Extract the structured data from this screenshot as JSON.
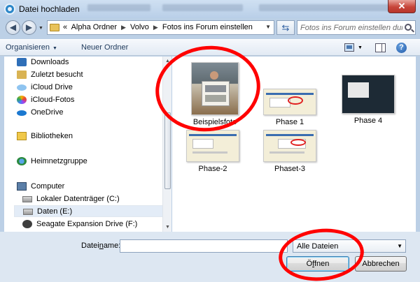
{
  "window": {
    "title": "Datei hochladen",
    "close_label": "✕"
  },
  "address": {
    "prefix": "«",
    "crumbs": [
      "Alpha Ordner",
      "Volvo",
      "Fotos ins Forum einstellen"
    ],
    "search_placeholder": "Fotos ins Forum einstellen durc..."
  },
  "toolbar": {
    "organize_label": "Organisieren",
    "new_folder_label": "Neuer Ordner",
    "help_label": "?"
  },
  "sidebar": {
    "favorites": [
      "Downloads",
      "Zuletzt besucht",
      "iCloud Drive",
      "iCloud-Fotos",
      "OneDrive"
    ],
    "libraries": "Bibliotheken",
    "homegroup": "Heimnetzgruppe",
    "computer": "Computer",
    "drives": [
      "Lokaler Datenträger (C:)",
      "Daten (E:)",
      "Seagate Expansion Drive (F:)"
    ],
    "selected": "Daten (E:)"
  },
  "files": [
    {
      "name": "Beispielsfoto"
    },
    {
      "name": "Phase 1"
    },
    {
      "name": "Phase 4"
    },
    {
      "name": "Phase-2"
    },
    {
      "name": "Phaset-3"
    }
  ],
  "bottom": {
    "filename_label_pre": "Datei",
    "filename_label_ul": "n",
    "filename_label_post": "ame:",
    "filename_value": "",
    "filter_value": "Alle Dateien",
    "open_pre": "Ö",
    "open_ul": "f",
    "open_post": "fnen",
    "cancel_label": "Abbrechen"
  },
  "colors": {
    "annotation": "#ff0000",
    "accent": "#2f6fb8"
  }
}
